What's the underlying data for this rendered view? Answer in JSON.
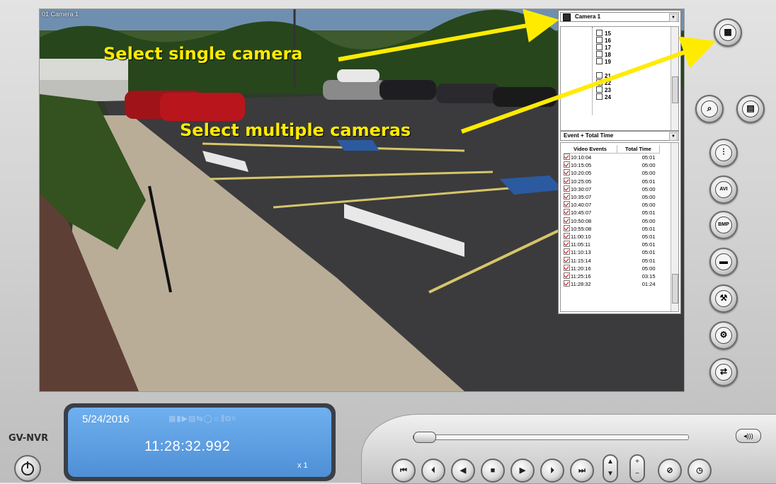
{
  "camera_view": {
    "label": "01 Camera 1"
  },
  "camera_select": {
    "value": "Camera 1"
  },
  "camera_tree": {
    "items": [
      "15",
      "16",
      "17",
      "18",
      "19",
      "21",
      "22",
      "23",
      "24"
    ]
  },
  "event_mode": {
    "value": "Event + Total Time"
  },
  "events_table": {
    "headers": [
      "Video Events",
      "Total Time"
    ],
    "rows": [
      [
        "10:10:04",
        "05:01"
      ],
      [
        "10:15:05",
        "05:00"
      ],
      [
        "10:20:05",
        "05:00"
      ],
      [
        "10:25:05",
        "05:01"
      ],
      [
        "10:30:07",
        "05:00"
      ],
      [
        "10:35:07",
        "05:00"
      ],
      [
        "10:40:07",
        "05:00"
      ],
      [
        "10:45:07",
        "05:01"
      ],
      [
        "10:50:08",
        "05:00"
      ],
      [
        "10:55:08",
        "05:01"
      ],
      [
        "11:00:10",
        "05:01"
      ],
      [
        "11:05:11",
        "05:01"
      ],
      [
        "11:10:13",
        "05:01"
      ],
      [
        "11:15:14",
        "05:01"
      ],
      [
        "11:20:16",
        "05:00"
      ],
      [
        "11:25:16",
        "03:15"
      ],
      [
        "11:28:32",
        "01:24"
      ]
    ]
  },
  "annotations": {
    "single": "Select single camera",
    "multiple": "Select multiple cameras",
    "color": "#ffeb00"
  },
  "brand": "GV-NVR",
  "lcd": {
    "date": "5/24/2016",
    "time": "11:28:32.992",
    "speed": "x 1"
  },
  "right_buttons": [
    "multi-camera-icon",
    "search-icon",
    "list-icon",
    "settings-sliders-icon",
    "save-avi-icon",
    "save-bmp-icon",
    "print-icon",
    "tools-icon",
    "config-icon",
    "export-icon"
  ],
  "playback": [
    "skip-start-icon",
    "previous-icon",
    "step-back-icon",
    "stop-icon",
    "play-icon",
    "next-icon",
    "skip-end-icon",
    "speed-updown-icon",
    "zoom-plusminus-icon",
    "audio-icon",
    "clock-icon"
  ],
  "colors": {
    "lcd_blue": "#5a9be0",
    "annotation_yellow": "#ffeb00"
  }
}
